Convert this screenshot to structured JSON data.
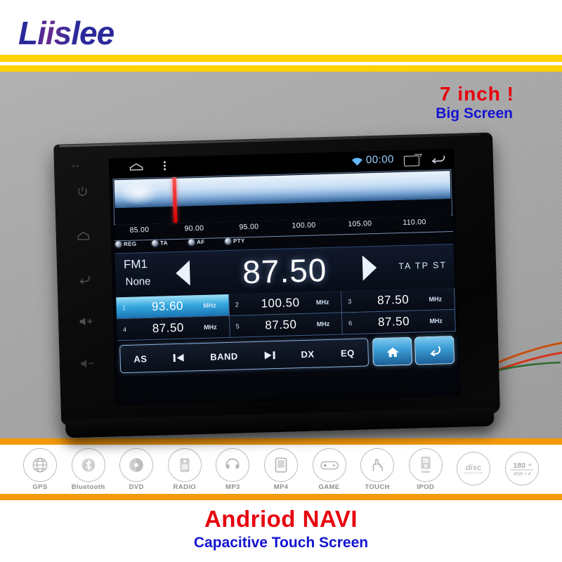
{
  "brand": {
    "logo_text": "Liislee"
  },
  "header": {
    "size_label": "7 inch !",
    "screen_label": "Big Screen"
  },
  "device": {
    "bezel_keys": [
      {
        "name": "power",
        "glyph": "⏻"
      },
      {
        "name": "home",
        "glyph": "⌂"
      },
      {
        "name": "back",
        "glyph": "↩"
      },
      {
        "name": "volume-up",
        "glyph": "🔊"
      },
      {
        "name": "volume-down",
        "glyph": "🔉"
      }
    ]
  },
  "screen": {
    "statusbar": {
      "clock": "00:00",
      "icons": [
        "home-icon",
        "menu-icon",
        "wifi-icon",
        "recents-icon",
        "back-icon"
      ]
    },
    "tuner": {
      "scale_labels": [
        "85.00",
        "90.00",
        "95.00",
        "100.00",
        "105.00",
        "110.00"
      ],
      "scale_min": 85.0,
      "scale_max": 110.0,
      "marker_frequency": "87.50"
    },
    "rds_indicators": [
      "REG",
      "TA",
      "AF",
      "PTY"
    ],
    "now": {
      "band": "FM1",
      "pty_text": "None",
      "frequency": "87.50",
      "status_flags": "TA TP ST"
    },
    "presets": [
      {
        "num": "1",
        "value": "93.60",
        "unit": "MHz",
        "active": true
      },
      {
        "num": "2",
        "value": "100.50",
        "unit": "MHz",
        "active": false
      },
      {
        "num": "3",
        "value": "87.50",
        "unit": "MHz",
        "active": false
      },
      {
        "num": "4",
        "value": "87.50",
        "unit": "MHz",
        "active": false
      },
      {
        "num": "5",
        "value": "87.50",
        "unit": "MHz",
        "active": false
      },
      {
        "num": "6",
        "value": "87.50",
        "unit": "MHz",
        "active": false
      }
    ],
    "toolbar": {
      "items": [
        "AS",
        "prev-icon",
        "BAND",
        "next-icon",
        "DX",
        "EQ"
      ],
      "as_label": "AS",
      "band_label": "BAND",
      "dx_label": "DX",
      "eq_label": "EQ",
      "home_icon": "home-icon",
      "back_icon": "back-icon"
    }
  },
  "features": [
    {
      "label": "GPS",
      "icon": "globe-icon"
    },
    {
      "label": "Bluetooth",
      "icon": "bluetooth-icon"
    },
    {
      "label": "DVD",
      "icon": "disc-icon"
    },
    {
      "label": "RADIO",
      "icon": "radio-icon"
    },
    {
      "label": "MP3",
      "icon": "headphone-icon"
    },
    {
      "label": "MP4",
      "icon": "screen-icon"
    },
    {
      "label": "GAME",
      "icon": "gamepad-icon"
    },
    {
      "label": "TOUCH",
      "icon": "hand-icon"
    },
    {
      "label": "IPOD",
      "icon": "ipod-icon"
    },
    {
      "label": "",
      "icon": "compact-disc-logo"
    },
    {
      "label": "",
      "icon": "power-180w-badge"
    }
  ],
  "power_badge": {
    "watts": "180",
    "unit": "W",
    "sub": "45W × 4"
  },
  "disc_badge": {
    "text": "disc",
    "sub": "DIGITAL AUDIO"
  },
  "footer": {
    "title": "Andriod NAVI",
    "subtitle": "Capacitive Touch Screen"
  },
  "colors": {
    "yellow": "#ffd200",
    "orange": "#f59a0b",
    "red": "#e8000d",
    "blue": "#1414d2",
    "gray_bg": "#a9a9a9"
  }
}
